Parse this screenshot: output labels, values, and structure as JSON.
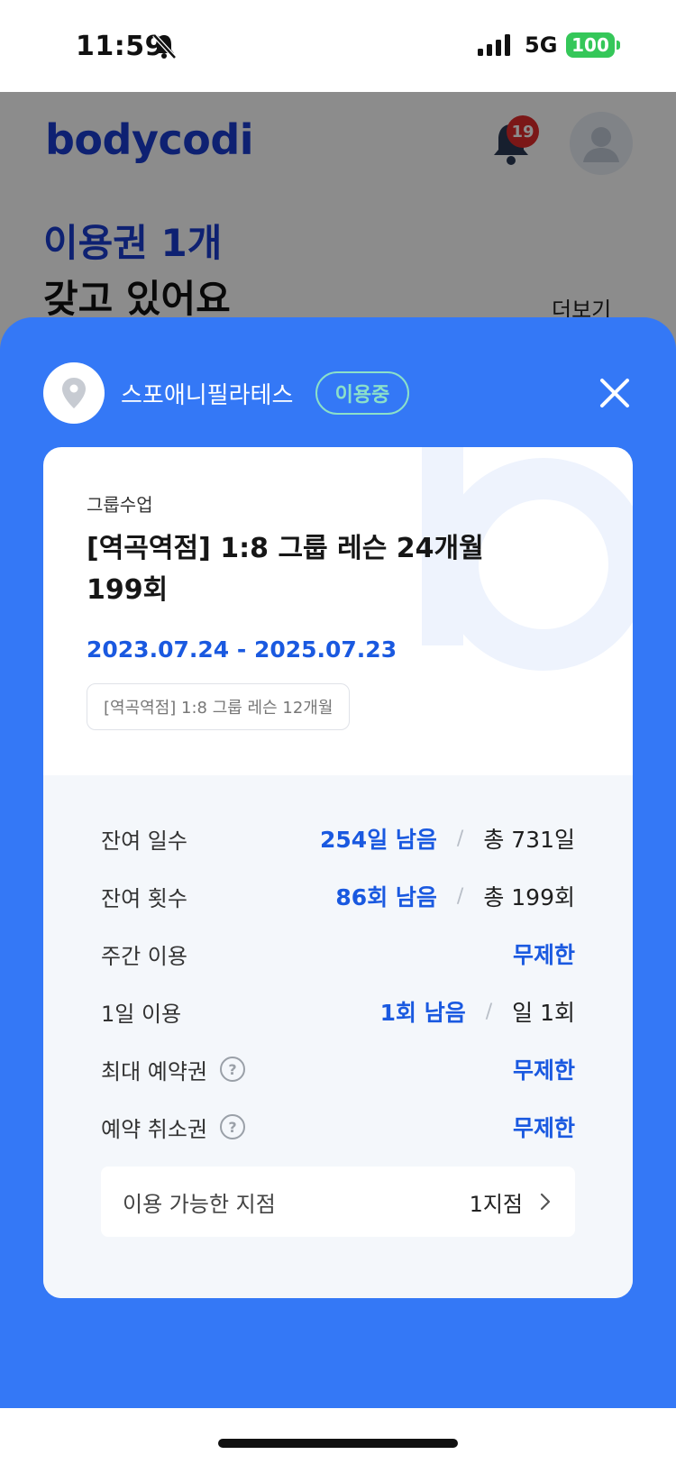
{
  "status_bar": {
    "time": "11:59",
    "network": "5G",
    "battery": "100"
  },
  "background": {
    "logo": "bodycodi",
    "notification_count": "19",
    "pass_count": "이용권 1개",
    "subtitle": "갖고 있어요",
    "more": "더보기"
  },
  "sheet": {
    "studio_name": "스포애니필라테스",
    "status": "이용중",
    "card": {
      "category": "그룹수업",
      "title": "[역곡역점] 1:8 그룹 레슨 24개월 199회",
      "period": "2023.07.24 - 2025.07.23",
      "tag": "[역곡역점] 1:8 그룹 레슨 12개월",
      "stats": [
        {
          "label": "잔여 일수",
          "remain": "254일 남음",
          "sep": "/",
          "total": "총 731일"
        },
        {
          "label": "잔여 횟수",
          "remain": "86회 남음",
          "sep": "/",
          "total": "총 199회"
        },
        {
          "label": "주간 이용",
          "remain": "무제한"
        },
        {
          "label": "1일 이용",
          "remain": "1회 남음",
          "sep": "/",
          "total": "일 1회"
        },
        {
          "label": "최대 예약권",
          "remain": "무제한"
        },
        {
          "label": "예약 취소권",
          "remain": "무제한"
        }
      ],
      "branch": {
        "label": "이용 가능한 지점",
        "count": "1지점"
      }
    }
  },
  "colors": {
    "sheet_blue": "#3478f6",
    "accent_blue": "#1a59e0",
    "status_mint": "#8be0c9"
  }
}
